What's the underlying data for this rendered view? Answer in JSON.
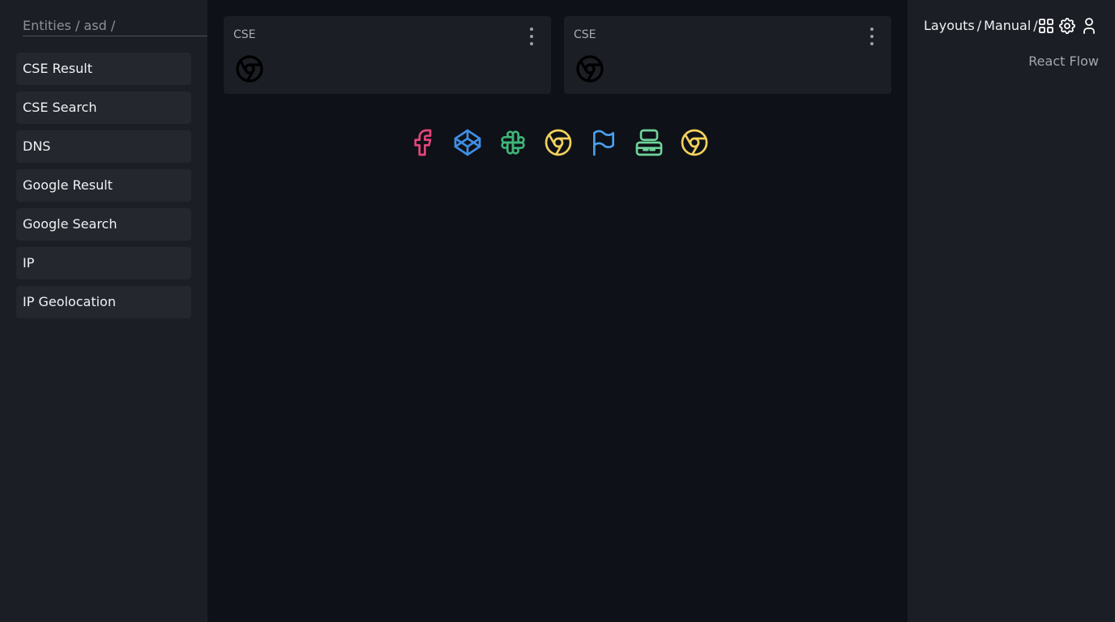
{
  "sidebar": {
    "breadcrumb": "Entities / asd /",
    "items": [
      {
        "label": "CSE Result"
      },
      {
        "label": "CSE Search"
      },
      {
        "label": "DNS"
      },
      {
        "label": "Google Result"
      },
      {
        "label": "Google Search"
      },
      {
        "label": "IP"
      },
      {
        "label": "IP Geolocation"
      }
    ]
  },
  "cards": [
    {
      "title": "CSE",
      "icon": "chrome-icon"
    },
    {
      "title": "CSE",
      "icon": "chrome-icon"
    }
  ],
  "toolbar_icons": [
    {
      "name": "facebook-icon",
      "color": "#e2467a"
    },
    {
      "name": "codepen-icon",
      "color": "#3e8fe6"
    },
    {
      "name": "slack-icon",
      "color": "#3fb57a"
    },
    {
      "name": "chrome-icon",
      "color": "#f2d15c"
    },
    {
      "name": "flag-icon",
      "color": "#4a9ff0"
    },
    {
      "name": "device-desktop-icon",
      "color": "#6fd39a"
    },
    {
      "name": "chrome-icon",
      "color": "#f2d15c"
    }
  ],
  "header": {
    "crumb1": "Layouts",
    "sep1": "/",
    "crumb2": "Manual",
    "sep2": "/",
    "subtitle": "React Flow"
  }
}
